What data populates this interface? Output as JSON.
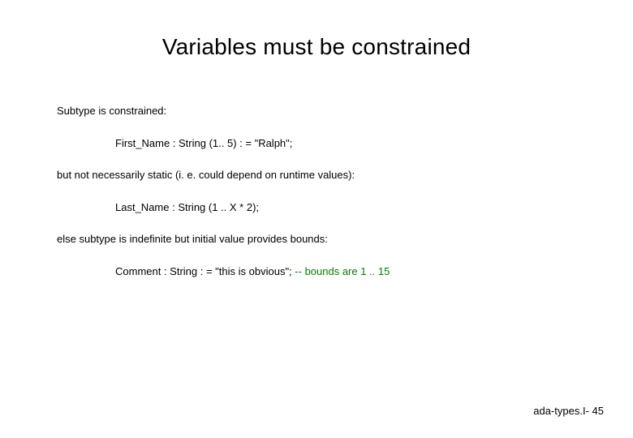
{
  "slide": {
    "title": "Variables must be constrained",
    "lines": {
      "l1": "Subtype is constrained:",
      "l2": "First_Name : String (1.. 5) : = \"Ralph\";",
      "l3": "but not necessarily static (i. e. could depend on runtime values):",
      "l4": "Last_Name : String (1 .. X * 2);",
      "l5": " else subtype is indefinite but initial value provides bounds:",
      "l6_code": "Comment  : String : = \"this is obvious\";  ",
      "l6_comment": "-- bounds are 1 .. 15"
    },
    "footer": "ada-types.I- 45"
  }
}
